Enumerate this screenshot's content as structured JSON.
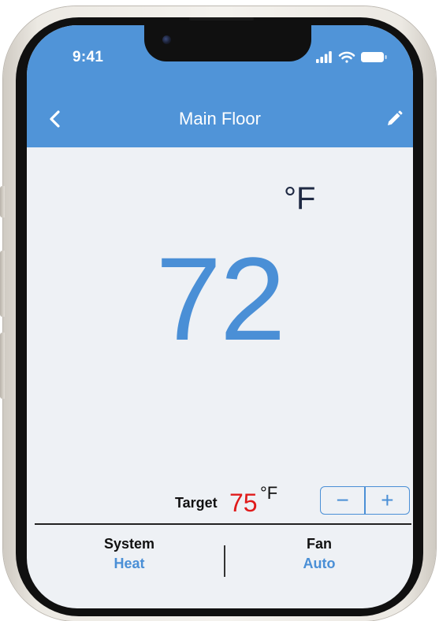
{
  "status_bar": {
    "time": "9:41"
  },
  "header": {
    "title": "Main Floor",
    "back_icon": "chevron-left-icon",
    "edit_icon": "pencil-icon"
  },
  "thermostat": {
    "unit": "°F",
    "current_temp": "72",
    "target_label": "Target",
    "target_value": "75",
    "target_unit": "°F",
    "decrement_label": "−",
    "increment_label": "+"
  },
  "modes": {
    "system": {
      "label": "System",
      "value": "Heat"
    },
    "fan": {
      "label": "Fan",
      "value": "Auto"
    }
  },
  "colors": {
    "header": "#5094d8",
    "accent": "#4a8fd6",
    "target": "#e01b1b"
  }
}
